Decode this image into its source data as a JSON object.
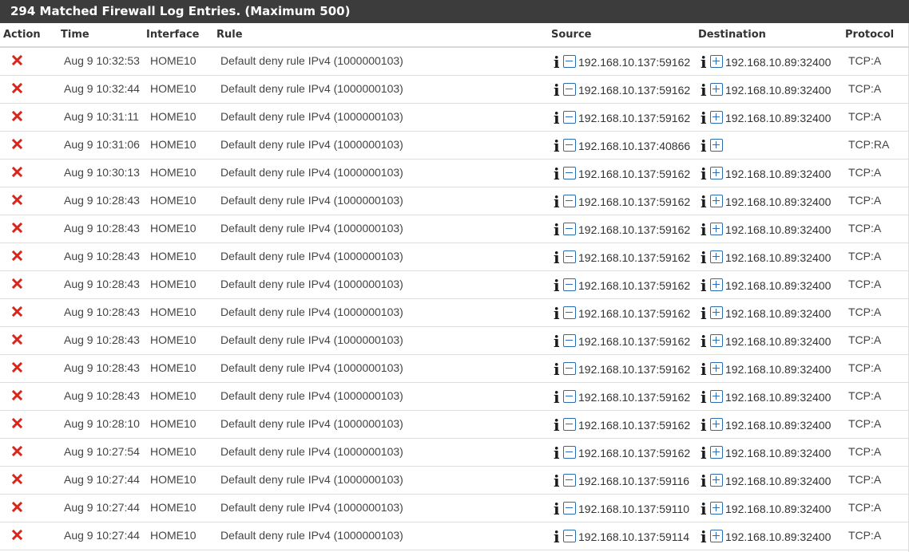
{
  "heading": "294 Matched Firewall Log Entries. (Maximum 500)",
  "columns": {
    "action": "Action",
    "time": "Time",
    "interface": "Interface",
    "rule": "Rule",
    "source": "Source",
    "destination": "Destination",
    "protocol": "Protocol"
  },
  "colors": {
    "block": "#d9261c",
    "link_icon": "#2b6cb0",
    "header_bg": "#3c3c3c"
  },
  "icons": {
    "action": "block-x-icon",
    "info": "info-icon",
    "source": "minus-box-icon",
    "destination": "plus-box-icon"
  },
  "rows": [
    {
      "time": "Aug 9 10:32:53",
      "interface": "HOME10",
      "rule": "Default deny rule IPv4 (1000000103)",
      "source": "192.168.10.137:59162",
      "destination": "192.168.10.89:32400",
      "protocol": "TCP:A"
    },
    {
      "time": "Aug 9 10:32:44",
      "interface": "HOME10",
      "rule": "Default deny rule IPv4 (1000000103)",
      "source": "192.168.10.137:59162",
      "destination": "192.168.10.89:32400",
      "protocol": "TCP:A"
    },
    {
      "time": "Aug 9 10:31:11",
      "interface": "HOME10",
      "rule": "Default deny rule IPv4 (1000000103)",
      "source": "192.168.10.137:59162",
      "destination": "192.168.10.89:32400",
      "protocol": "TCP:A"
    },
    {
      "time": "Aug 9 10:31:06",
      "interface": "HOME10",
      "rule": "Default deny rule IPv4 (1000000103)",
      "source": "192.168.10.137:40866",
      "destination": "",
      "protocol": "TCP:RA"
    },
    {
      "time": "Aug 9 10:30:13",
      "interface": "HOME10",
      "rule": "Default deny rule IPv4 (1000000103)",
      "source": "192.168.10.137:59162",
      "destination": "192.168.10.89:32400",
      "protocol": "TCP:A"
    },
    {
      "time": "Aug 9 10:28:43",
      "interface": "HOME10",
      "rule": "Default deny rule IPv4 (1000000103)",
      "source": "192.168.10.137:59162",
      "destination": "192.168.10.89:32400",
      "protocol": "TCP:A"
    },
    {
      "time": "Aug 9 10:28:43",
      "interface": "HOME10",
      "rule": "Default deny rule IPv4 (1000000103)",
      "source": "192.168.10.137:59162",
      "destination": "192.168.10.89:32400",
      "protocol": "TCP:A"
    },
    {
      "time": "Aug 9 10:28:43",
      "interface": "HOME10",
      "rule": "Default deny rule IPv4 (1000000103)",
      "source": "192.168.10.137:59162",
      "destination": "192.168.10.89:32400",
      "protocol": "TCP:A"
    },
    {
      "time": "Aug 9 10:28:43",
      "interface": "HOME10",
      "rule": "Default deny rule IPv4 (1000000103)",
      "source": "192.168.10.137:59162",
      "destination": "192.168.10.89:32400",
      "protocol": "TCP:A"
    },
    {
      "time": "Aug 9 10:28:43",
      "interface": "HOME10",
      "rule": "Default deny rule IPv4 (1000000103)",
      "source": "192.168.10.137:59162",
      "destination": "192.168.10.89:32400",
      "protocol": "TCP:A"
    },
    {
      "time": "Aug 9 10:28:43",
      "interface": "HOME10",
      "rule": "Default deny rule IPv4 (1000000103)",
      "source": "192.168.10.137:59162",
      "destination": "192.168.10.89:32400",
      "protocol": "TCP:A"
    },
    {
      "time": "Aug 9 10:28:43",
      "interface": "HOME10",
      "rule": "Default deny rule IPv4 (1000000103)",
      "source": "192.168.10.137:59162",
      "destination": "192.168.10.89:32400",
      "protocol": "TCP:A"
    },
    {
      "time": "Aug 9 10:28:43",
      "interface": "HOME10",
      "rule": "Default deny rule IPv4 (1000000103)",
      "source": "192.168.10.137:59162",
      "destination": "192.168.10.89:32400",
      "protocol": "TCP:A"
    },
    {
      "time": "Aug 9 10:28:10",
      "interface": "HOME10",
      "rule": "Default deny rule IPv4 (1000000103)",
      "source": "192.168.10.137:59162",
      "destination": "192.168.10.89:32400",
      "protocol": "TCP:A"
    },
    {
      "time": "Aug 9 10:27:54",
      "interface": "HOME10",
      "rule": "Default deny rule IPv4 (1000000103)",
      "source": "192.168.10.137:59162",
      "destination": "192.168.10.89:32400",
      "protocol": "TCP:A"
    },
    {
      "time": "Aug 9 10:27:44",
      "interface": "HOME10",
      "rule": "Default deny rule IPv4 (1000000103)",
      "source": "192.168.10.137:59116",
      "destination": "192.168.10.89:32400",
      "protocol": "TCP:A"
    },
    {
      "time": "Aug 9 10:27:44",
      "interface": "HOME10",
      "rule": "Default deny rule IPv4 (1000000103)",
      "source": "192.168.10.137:59110",
      "destination": "192.168.10.89:32400",
      "protocol": "TCP:A"
    },
    {
      "time": "Aug 9 10:27:44",
      "interface": "HOME10",
      "rule": "Default deny rule IPv4 (1000000103)",
      "source": "192.168.10.137:59114",
      "destination": "192.168.10.89:32400",
      "protocol": "TCP:A"
    }
  ]
}
